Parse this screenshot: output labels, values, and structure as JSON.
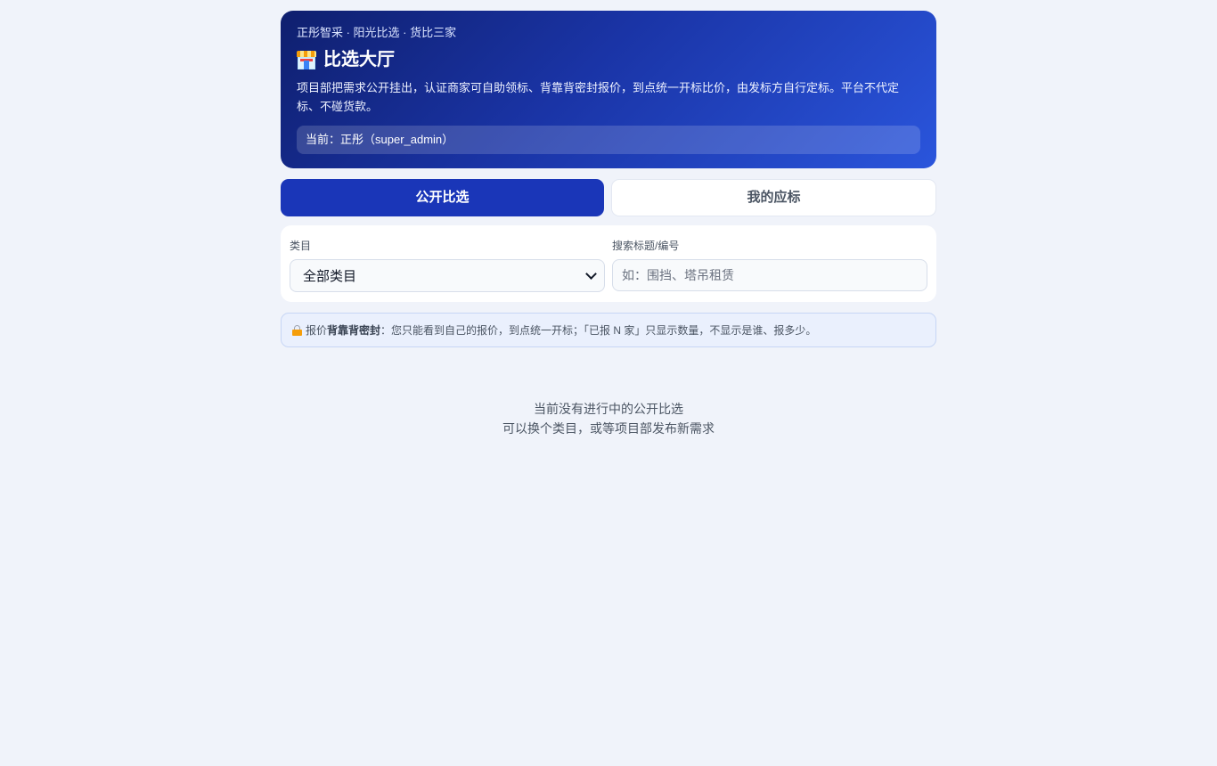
{
  "hero": {
    "tagline": "正彤智采 · 阳光比选 · 货比三家",
    "icon": "convenience-store-icon",
    "title": "比选大厅",
    "description": "项目部把需求公开挂出，认证商家可自助领标、背靠背密封报价，到点统一开标比价，由发标方自行定标。平台不代定标、不碰货款。",
    "current_user": "当前：正彤（super_admin）"
  },
  "tabs": [
    {
      "label": "公开比选",
      "active": true
    },
    {
      "label": "我的应标",
      "active": false
    }
  ],
  "filters": {
    "category_label": "类目",
    "category_value": "全部类目",
    "search_label": "搜索标题/编号",
    "search_placeholder": "如：围挡、塔吊租赁",
    "search_value": ""
  },
  "notice": {
    "icon": "lock-icon",
    "prefix": "报价",
    "emphasis": "背靠背密封",
    "text": "：您只能看到自己的报价，到点统一开标；「已报 N 家」只显示数量，不显示是谁、报多少。"
  },
  "empty_state": {
    "line1": "当前没有进行中的公开比选",
    "line2": "可以换个类目，或等项目部发布新需求"
  },
  "colors": {
    "background": "#f0f3fa",
    "hero_start": "#0f1f6e",
    "hero_end": "#2a55dc",
    "active_tab": "#1a36b8"
  }
}
